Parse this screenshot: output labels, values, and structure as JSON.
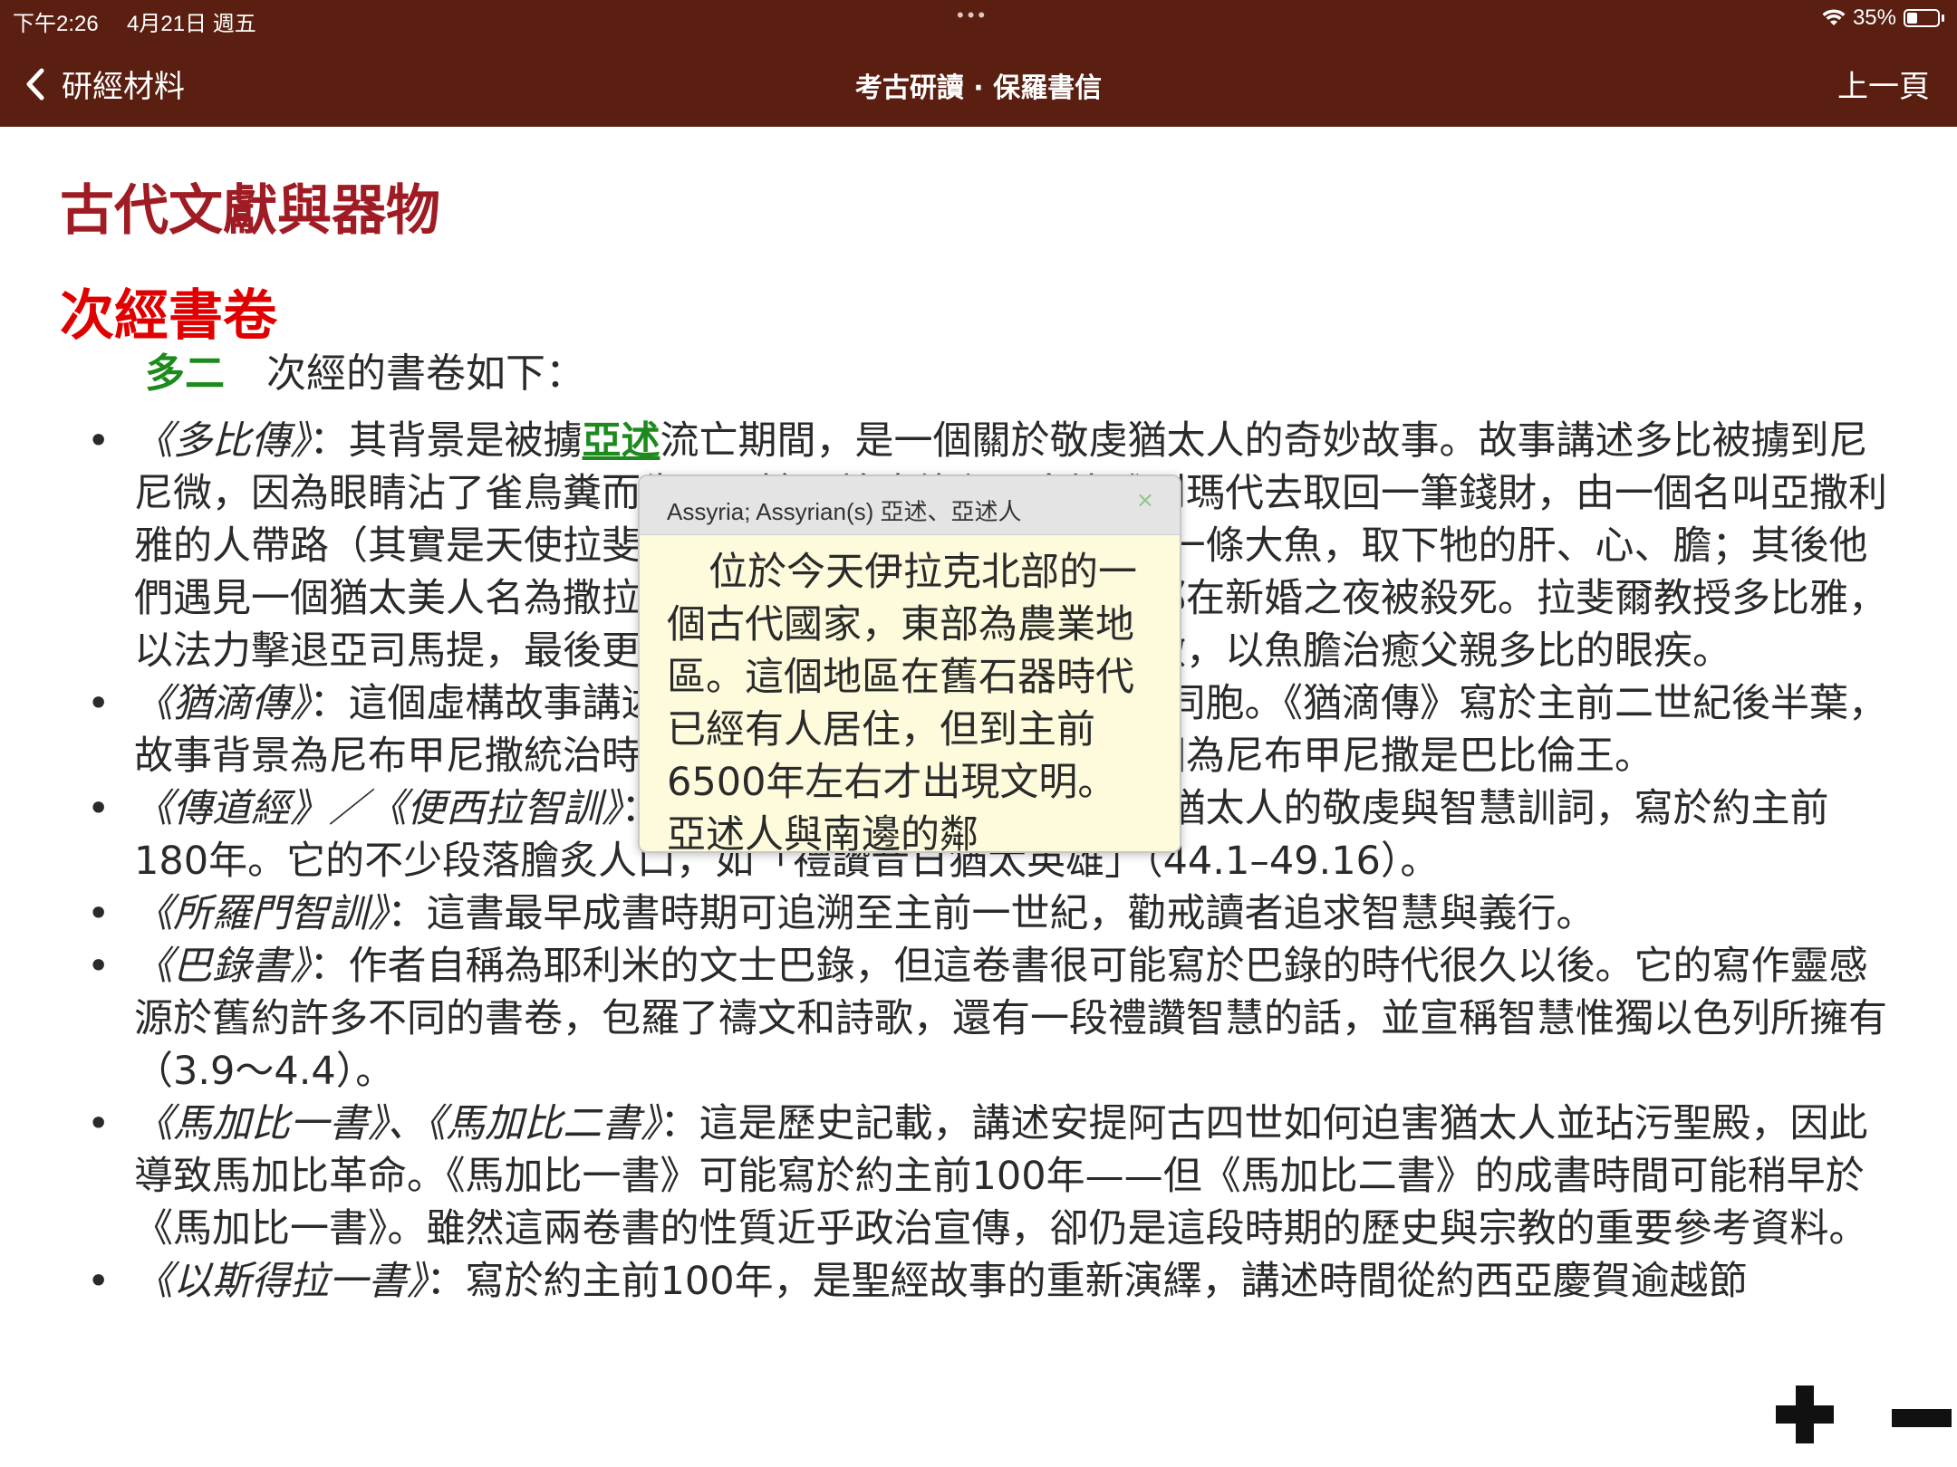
{
  "status": {
    "time": "下午2:26",
    "date": "4月21日 週五",
    "battery": "35%",
    "battery_level": 0.35,
    "multitask_dots": "•••"
  },
  "nav": {
    "back_label": "研經材料",
    "title": "考古研讀 · 保羅書信",
    "prev_label": "上一頁"
  },
  "page": {
    "heading": "古代文獻與器物",
    "subheading": "次經書卷",
    "intro_ref": "多二",
    "intro_text": "次經的書卷如下："
  },
  "items": [
    {
      "book": "《多比傳》",
      "pre": "：其背景是被擄",
      "link": "亞述",
      "text": "流亡期間，是一個關於敬虔猶太人的奇妙故事。故事講述多比被擄到尼尼微，因為眼睛沾了雀鳥糞而失明，於是差遣他兒子多比雅到瑪代去取回一筆錢財，由一個名叫亞撒利雅的人帶路（其實是天使拉斐爾）。拉斐爾指示多比雅去捉了一條大魚，取下牠的肝、心、膽；其後他們遇見一個猶太美人名為撒拉，她曾出嫁七次，但每個新郎都在新婚之夜被殺死。拉斐爾教授多比雅，以法力擊退亞司馬提，最後更娶了撒拉為妻，然後回到尼尼微，以魚膽治癒父親多比的眼疾。"
    },
    {
      "book": "《猶滴傳》",
      "text": "：這個虛構故事講述一位猶太寡婦如何拯救了她的同胞。《猶滴傳》寫於主前二世紀後半葉，故事背景為尼布甲尼撒統治時期，這個設定使人無法理解，因為尼布甲尼撒是巴比倫王。"
    },
    {
      "book": "《傳道經》／《便西拉智訓》",
      "text": "：這卷書包羅詩歌、禱文、傳統猶太人的敬虔與智慧訓詞，寫於約主前180年。它的不少段落膾炙人口，如「禮讚昔日猶太英雄」（44.1–49.16）。"
    },
    {
      "book": "《所羅門智訓》",
      "text": "：這書最早成書時期可追溯至主前一世紀，勸戒讀者追求智慧與義行。"
    },
    {
      "book": "《巴錄書》",
      "text": "：作者自稱為耶利米的文士巴錄，但這卷書很可能寫於巴錄的時代很久以後。它的寫作靈感源於舊約許多不同的書卷，包羅了禱文和詩歌，還有一段禮讚智慧的話，並宣稱智慧惟獨以色列所擁有（3.9～4.4）。"
    },
    {
      "book": "《馬加比一書》、《馬加比二書》",
      "text": "：這是歷史記載，講述安提阿古四世如何迫害猶太人並玷污聖殿，因此導致馬加比革命。《馬加比一書》可能寫於約主前100年——但《馬加比二書》的成書時間可能稍早於《馬加比一書》。雖然這兩卷書的性質近乎政治宣傳，卻仍是這段時期的歷史與宗教的重要參考資料。"
    },
    {
      "book": "《以斯得拉一書》",
      "text": "：寫於約主前100年，是聖經故事的重新演繹，講述時間從約西亞慶賀逾越節"
    }
  ],
  "popup": {
    "title": "Assyria; Assyrian(s) 亞述、亞述人",
    "close": "×",
    "body": "位於今天伊拉克北部的一個古代國家，東部為農業地區。這個地區在舊石器時代已經有人居住，但到主前6500年左右才出現文明。亞述人與南邊的鄰"
  },
  "colors": {
    "bar": "#5a1f10",
    "heading": "#a01c24",
    "subheading": "#e00000",
    "link": "#1c8a1c",
    "popup_bg": "#fdfbdc"
  },
  "icons": {
    "back": "chevron-left-icon",
    "wifi": "wifi-icon",
    "battery": "battery-icon",
    "zoom_in": "plus-icon",
    "zoom_out": "minus-icon"
  }
}
